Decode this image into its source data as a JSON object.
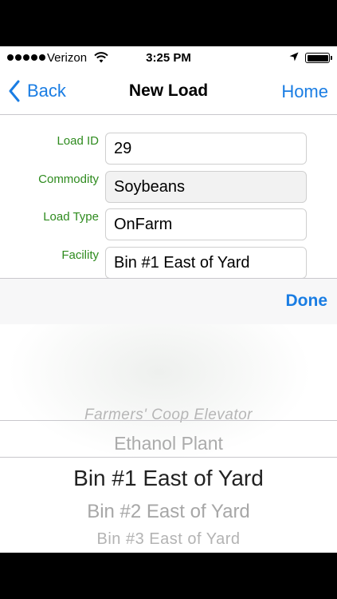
{
  "status": {
    "carrier": "Verizon",
    "time": "3:25 PM"
  },
  "nav": {
    "back_label": "Back",
    "title": "New Load",
    "home_label": "Home"
  },
  "form": {
    "load_id": {
      "label": "Load ID",
      "value": "29"
    },
    "commodity": {
      "label": "Commodity",
      "value": "Soybeans"
    },
    "load_type": {
      "label": "Load Type",
      "value": "OnFarm"
    },
    "facility": {
      "label": "Facility",
      "value": "Bin #1 East of Yard"
    }
  },
  "picker": {
    "done_label": "Done",
    "options": [
      "Farmers' Coop Elevator",
      "Ethanol Plant",
      "Bin #1 East of Yard",
      "Bin #2 East of Yard",
      "Bin #3 East of Yard"
    ],
    "selected": "Bin #1 East of Yard"
  },
  "colors": {
    "accent": "#1a7de3",
    "label_green": "#2e8b1e"
  },
  "icons": [
    "wifi-icon",
    "location-arrow-icon",
    "battery-icon",
    "chevron-left-icon"
  ]
}
